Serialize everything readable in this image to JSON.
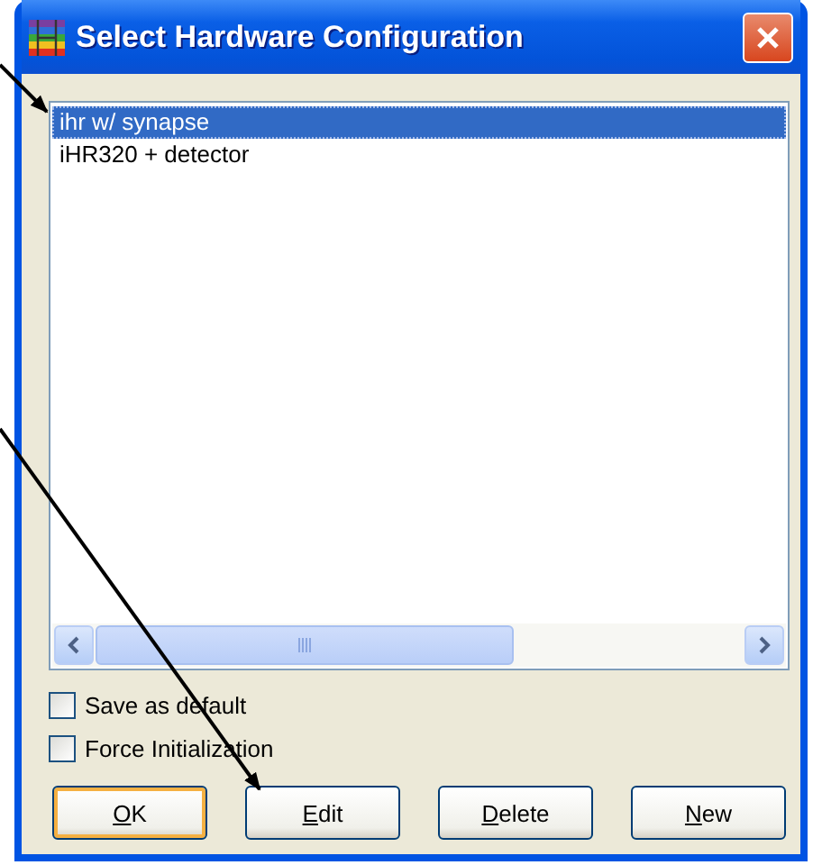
{
  "window": {
    "title": "Select Hardware Configuration"
  },
  "list": {
    "items": [
      {
        "label": "ihr w/ synapse",
        "selected": true
      },
      {
        "label": "iHR320 + detector",
        "selected": false
      }
    ]
  },
  "options": [
    {
      "label": "Save as default",
      "checked": false
    },
    {
      "label": "Force Initialization",
      "checked": false
    }
  ],
  "buttons": [
    {
      "label": "OK",
      "default": true,
      "mnemonic_underlined": true
    },
    {
      "label": "Edit",
      "default": false,
      "mnemonic_underlined": true
    },
    {
      "label": "Delete",
      "default": false,
      "mnemonic_underlined": true
    },
    {
      "label": "New",
      "default": false,
      "mnemonic_underlined": true
    }
  ]
}
